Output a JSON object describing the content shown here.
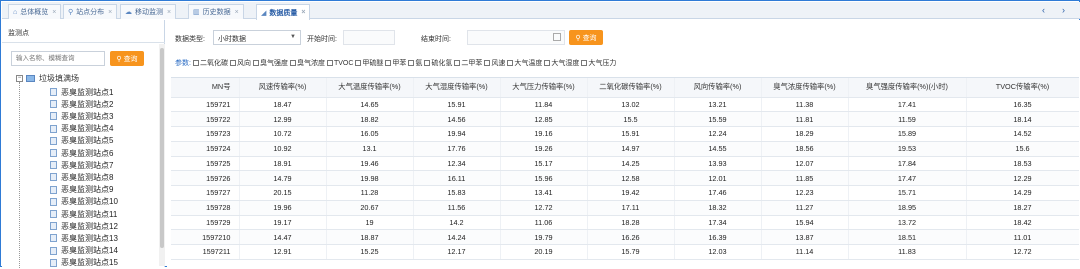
{
  "tabs": [
    {
      "icon": "home-icon",
      "glyph": "⌂",
      "label": "总体概览",
      "active": false
    },
    {
      "icon": "location-icon",
      "glyph": "⚲",
      "label": "站点分布",
      "active": false
    },
    {
      "icon": "cloud-icon",
      "glyph": "☁",
      "label": "移动监测",
      "active": false
    },
    {
      "icon": "bar-chart-icon",
      "glyph": "▥",
      "label": "历史数据",
      "active": false
    },
    {
      "icon": "send-icon",
      "glyph": "◢",
      "label": "数据质量",
      "active": true
    }
  ],
  "tab_close": "×",
  "tab_nav": {
    "prev": "‹",
    "next": "›"
  },
  "left": {
    "title": "监测点",
    "search_placeholder": "输入名称、模糊查询",
    "search_button": "查询",
    "tree_root": "垃圾填满场",
    "stations": [
      "恶臭监测站点1",
      "恶臭监测站点2",
      "恶臭监测站点3",
      "恶臭监测站点4",
      "恶臭监测站点5",
      "恶臭监测站点6",
      "恶臭监测站点7",
      "恶臭监测站点8",
      "恶臭监测站点9",
      "恶臭监测站点10",
      "恶臭监测站点11",
      "恶臭监测站点12",
      "恶臭监测站点13",
      "恶臭监测站点14",
      "恶臭监测站点15"
    ]
  },
  "filters": {
    "type_label": "数据类型:",
    "type_value": "小时数据",
    "start_label": "开始时间:",
    "end_label": "结束时间:",
    "query_button": "查询",
    "params_label": "参数:",
    "params": [
      "二氧化碳",
      "风向",
      "臭气强度",
      "臭气浓度",
      "TVOC",
      "甲硫醚",
      "甲苯",
      "氨",
      "硫化氢",
      "二甲苯",
      "风速",
      "大气温度",
      "大气湿度",
      "大气压力"
    ]
  },
  "table": {
    "headers": [
      "MN号",
      "风速传输率(%)",
      "大气温度传输率(%)",
      "大气湿度传输率(%)",
      "大气压力传输率(%)",
      "二氧化碳传输率(%)",
      "风向传输率(%)",
      "臭气浓度传输率(%)",
      "臭气强度传输率(%)(小时)",
      "TVOC传输率(%)"
    ],
    "rows": [
      [
        "159721",
        "18.47",
        "14.65",
        "15.91",
        "11.84",
        "13.02",
        "13.21",
        "11.38",
        "17.41",
        "16.35"
      ],
      [
        "159722",
        "12.99",
        "18.82",
        "14.56",
        "12.85",
        "15.5",
        "15.59",
        "11.81",
        "11.59",
        "18.14"
      ],
      [
        "159723",
        "10.72",
        "16.05",
        "19.94",
        "19.16",
        "15.91",
        "12.24",
        "18.29",
        "15.89",
        "14.52"
      ],
      [
        "159724",
        "10.92",
        "13.1",
        "17.76",
        "19.26",
        "14.97",
        "14.55",
        "18.56",
        "19.53",
        "15.6"
      ],
      [
        "159725",
        "18.91",
        "19.46",
        "12.34",
        "15.17",
        "14.25",
        "13.93",
        "12.07",
        "17.84",
        "18.53"
      ],
      [
        "159726",
        "14.79",
        "19.98",
        "16.11",
        "15.96",
        "12.58",
        "12.01",
        "11.85",
        "17.47",
        "12.29"
      ],
      [
        "159727",
        "20.15",
        "11.28",
        "15.83",
        "13.41",
        "19.42",
        "17.46",
        "12.23",
        "15.71",
        "14.29"
      ],
      [
        "159728",
        "19.96",
        "20.67",
        "11.56",
        "12.72",
        "17.11",
        "18.32",
        "11.27",
        "18.95",
        "18.27"
      ],
      [
        "159729",
        "19.17",
        "19",
        "14.2",
        "11.06",
        "18.28",
        "17.34",
        "15.94",
        "13.72",
        "18.42"
      ],
      [
        "1597210",
        "14.47",
        "18.87",
        "14.24",
        "19.79",
        "16.26",
        "16.39",
        "13.87",
        "18.51",
        "11.01"
      ],
      [
        "1597211",
        "12.91",
        "15.25",
        "12.17",
        "20.19",
        "15.79",
        "12.03",
        "11.14",
        "11.83",
        "12.72"
      ]
    ]
  }
}
